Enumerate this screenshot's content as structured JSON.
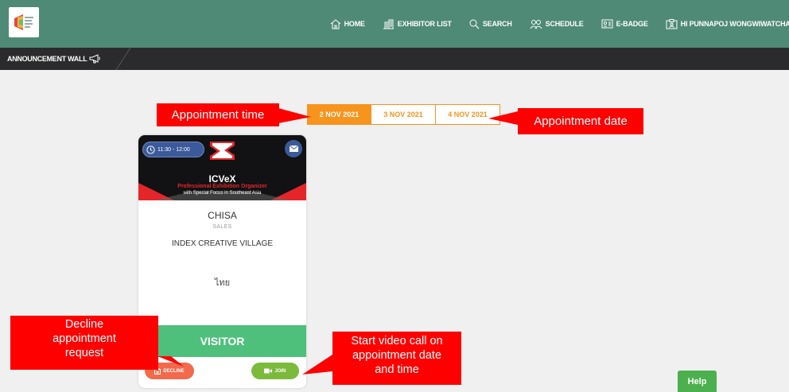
{
  "nav": {
    "home": "HOME",
    "exhibitor_list": "EXHIBITOR LIST",
    "search": "SEARCH",
    "schedule": "SCHEDULE",
    "ebadge": "E-BADGE",
    "user": "HI PUNNAPOJ WONGWIWATCHAI"
  },
  "subbar": {
    "announcement": "ANNOUNCEMENT WALL"
  },
  "tabs": [
    {
      "label": "2 NOV 2021",
      "active": true
    },
    {
      "label": "3 NOV 2021",
      "active": false
    },
    {
      "label": "4 NOV 2021",
      "active": false
    }
  ],
  "card": {
    "time": "11:30 - 12:00",
    "brand": "ICVeX",
    "brand_line1": "Professional Exhibition Organizer",
    "brand_line2": "with Special Focus in Southeast Asia",
    "name": "CHISA",
    "role": "SALES",
    "company": "INDEX CREATIVE VILLAGE",
    "country": "ไทย",
    "type": "VISITOR",
    "decline_label": "DECLINE",
    "join_label": "JOIN"
  },
  "callouts": {
    "appointment_time": "Appointment time",
    "appointment_date": "Appointment date",
    "decline_line1": "Decline",
    "decline_line2": "appointment",
    "decline_line3": "request",
    "video_line1": "Start video call on",
    "video_line2": "appointment date",
    "video_line3": "and time"
  },
  "help": "Help",
  "colors": {
    "header": "#4f8a77",
    "subbar": "#2b2b2d",
    "accent_orange": "#f7941d",
    "visitor_green": "#4ec07b",
    "decline_red": "#f26a4b",
    "join_green": "#7cba3c",
    "callout_red": "#ff0000"
  }
}
